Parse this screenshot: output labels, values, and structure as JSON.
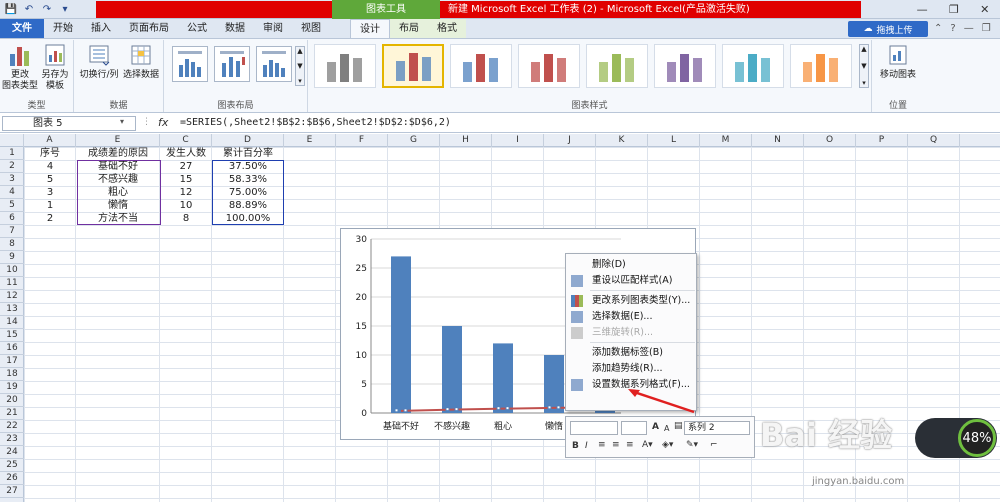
{
  "window": {
    "title": "新建 Microsoft Excel 工作表 (2) - Microsoft Excel(产品激活失败)",
    "chart_tools_label": "图表工具",
    "controls": [
      "—",
      "❐",
      "✕"
    ]
  },
  "qat": [
    "💾",
    "↶",
    "↷",
    "▾"
  ],
  "tabs": [
    {
      "label": "文件",
      "kind": "file"
    },
    {
      "label": "开始"
    },
    {
      "label": "插入"
    },
    {
      "label": "页面布局"
    },
    {
      "label": "公式"
    },
    {
      "label": "数据"
    },
    {
      "label": "审阅"
    },
    {
      "label": "视图"
    },
    {
      "label": "设计",
      "kind": "ctx-active"
    },
    {
      "label": "布局",
      "kind": "ctx"
    },
    {
      "label": "格式",
      "kind": "ctx"
    }
  ],
  "upload_button": "拖拽上传",
  "ribbon": {
    "groups": {
      "type": "类型",
      "data": "数据",
      "chart_layout": "图表布局",
      "chart_styles": "图表样式",
      "location": "位置"
    },
    "buttons": {
      "change_type": "更改\n图表类型",
      "save_template": "另存为\n模板",
      "switch_rowcol": "切换行/列",
      "select_data": "选择数据",
      "move_chart": "移动图表"
    },
    "style_colors": [
      "#7f7f7f",
      "#4f81bd",
      "#4f81bd",
      "#c0504d",
      "#9bbb59",
      "#8064a2",
      "#4bacc6",
      "#f79646"
    ]
  },
  "formula_bar": {
    "name_box": "图表 5",
    "fx": "fx",
    "formula": "=SERIES(,Sheet2!$B$2:$B$6,Sheet2!$D$2:$D$6,2)"
  },
  "columns": [
    "A",
    "E",
    "C",
    "D",
    "E",
    "F",
    "G",
    "H",
    "I",
    "J",
    "K",
    "L",
    "M",
    "N",
    "O",
    "P",
    "Q"
  ],
  "rows": [
    "1",
    "2",
    "3",
    "4",
    "5",
    "6",
    "7",
    "8",
    "9",
    "10",
    "11",
    "12",
    "13",
    "14",
    "15",
    "16",
    "17",
    "18",
    "19",
    "20",
    "21",
    "22",
    "23",
    "24",
    "25",
    "26",
    "27"
  ],
  "table": {
    "headers": [
      "序号",
      "成绩差的原因",
      "发生人数",
      "累计百分率"
    ],
    "rows": [
      [
        "4",
        "基础不好",
        "27",
        "37.50%"
      ],
      [
        "5",
        "不感兴趣",
        "15",
        "58.33%"
      ],
      [
        "3",
        "粗心",
        "12",
        "75.00%"
      ],
      [
        "1",
        "懒惰",
        "10",
        "88.89%"
      ],
      [
        "2",
        "方法不当",
        "8",
        "100.00%"
      ]
    ]
  },
  "chart_data": {
    "type": "bar",
    "categories": [
      "基础不好",
      "不感兴趣",
      "粗心",
      "懒惰",
      "方法不当"
    ],
    "series": [
      {
        "values": [
          27,
          15,
          12,
          10,
          8
        ],
        "color": "#4f81bd"
      },
      {
        "values": [
          0.375,
          0.5833,
          0.75,
          0.8889,
          1.0
        ],
        "color": "#c0504d",
        "type": "line"
      }
    ],
    "yticks": [
      "30",
      "25",
      "20",
      "15",
      "10",
      "5",
      "0"
    ],
    "ylim": [
      0,
      30
    ]
  },
  "context_menu": [
    {
      "label": "删除(D)",
      "icon": "",
      "disabled": false
    },
    {
      "label": "重设以匹配样式(A)",
      "icon": "reset-style-icon",
      "disabled": false
    },
    {
      "sep": true
    },
    {
      "label": "更改系列图表类型(Y)...",
      "icon": "chart-type-icon",
      "disabled": false
    },
    {
      "label": "选择数据(E)...",
      "icon": "select-data-icon",
      "disabled": false
    },
    {
      "label": "三维旋转(R)...",
      "icon": "rotate-3d-icon",
      "disabled": true
    },
    {
      "sep": true
    },
    {
      "label": "添加数据标签(B)",
      "icon": "",
      "disabled": false
    },
    {
      "label": "添加趋势线(R)...",
      "icon": "",
      "disabled": false
    },
    {
      "label": "设置数据系列格式(F)...",
      "icon": "format-series-icon",
      "disabled": false
    }
  ],
  "mini_toolbar": {
    "series_label": "系列 2",
    "bold": "B",
    "italic": "I",
    "grow_font": "A",
    "shrink_font": "A"
  },
  "watermark": {
    "text": "Bai 经验",
    "sub": "jingyan.baidu.com"
  },
  "perf_meter": "48%"
}
